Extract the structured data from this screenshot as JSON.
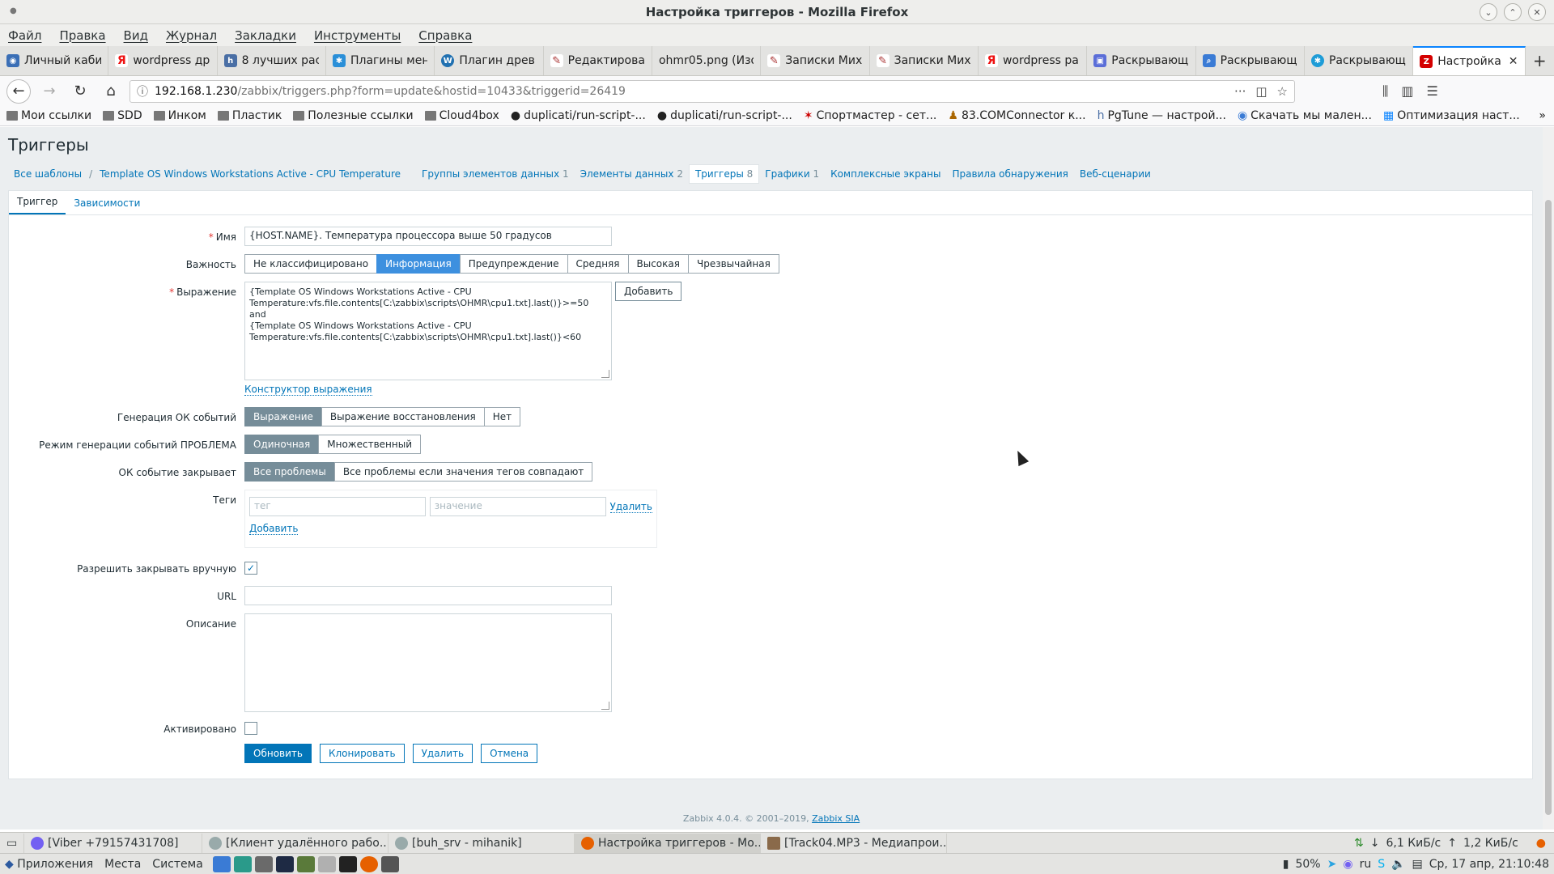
{
  "window": {
    "title": "Настройка триггеров - Mozilla Firefox"
  },
  "menubar": [
    "Файл",
    "Правка",
    "Вид",
    "Журнал",
    "Закладки",
    "Инструменты",
    "Справка"
  ],
  "tabs": [
    {
      "label": "Личный каби",
      "icon": "circle-icon",
      "color": "#3b6fb6"
    },
    {
      "label": "wordpress др",
      "icon": "yandex-icon",
      "color": "#e11"
    },
    {
      "label": "8 лучших рас",
      "icon": "h-icon",
      "color": "#4a6fa5"
    },
    {
      "label": "Плагины мен",
      "icon": "gear-icon",
      "color": "#2a8fd8"
    },
    {
      "label": "Плагин древ",
      "icon": "wordpress-icon",
      "color": "#2171b1"
    },
    {
      "label": "Редактирова",
      "icon": "feather-icon",
      "color": "#a33"
    },
    {
      "label": "ohmr05.png (Изо",
      "icon": "none",
      "color": "#e3e3e1"
    },
    {
      "label": "Записки Мих",
      "icon": "feather-icon",
      "color": "#a33"
    },
    {
      "label": "Записки Мих",
      "icon": "feather-icon",
      "color": "#a33"
    },
    {
      "label": "wordpress ра",
      "icon": "yandex-icon",
      "color": "#e11"
    },
    {
      "label": "Раскрывающ",
      "icon": "box-icon",
      "color": "#5b6ed8"
    },
    {
      "label": "Раскрывающ",
      "icon": "search-icon",
      "color": "#3a7bd5"
    },
    {
      "label": "Раскрывающ",
      "icon": "gear-icon",
      "color": "#1e9cd7"
    }
  ],
  "active_tab": {
    "label": "Настройка",
    "icon": "Z",
    "color": "#d40000"
  },
  "url": {
    "host": "192.168.1.230",
    "path": "/zabbix/triggers.php?form=update&hostid=10433&triggerid=26419"
  },
  "bookmarks": [
    {
      "label": "Мои ссылки",
      "type": "folder"
    },
    {
      "label": "SDD",
      "type": "folder"
    },
    {
      "label": "Инком",
      "type": "folder"
    },
    {
      "label": "Пластик",
      "type": "folder"
    },
    {
      "label": "Полезные ссылки",
      "type": "folder"
    },
    {
      "label": "Cloud4box",
      "type": "folder"
    },
    {
      "label": "duplicati/run-script-...",
      "type": "github"
    },
    {
      "label": "duplicati/run-script-...",
      "type": "github"
    },
    {
      "label": "Спортмастер - сет...",
      "type": "site"
    },
    {
      "label": "83.COMConnector к...",
      "type": "site"
    },
    {
      "label": "PgTune — настрой...",
      "type": "site"
    },
    {
      "label": "Скачать мы мален...",
      "type": "site"
    },
    {
      "label": "Оптимизация наст...",
      "type": "site"
    }
  ],
  "page": {
    "title": "Триггеры",
    "breadcrumbs": {
      "all_templates": "Все шаблоны",
      "template": "Template OS Windows Workstations Active - CPU Temperature",
      "items": [
        {
          "label": "Группы элементов данных",
          "count": "1"
        },
        {
          "label": "Элементы данных",
          "count": "2"
        },
        {
          "label": "Триггеры",
          "count": "8"
        },
        {
          "label": "Графики",
          "count": "1"
        },
        {
          "label": "Комплексные экраны",
          "count": ""
        },
        {
          "label": "Правила обнаружения",
          "count": ""
        },
        {
          "label": "Веб-сценарии",
          "count": ""
        }
      ]
    },
    "form_tabs": [
      "Триггер",
      "Зависимости"
    ],
    "form": {
      "name_label": "Имя",
      "name_value": "{HOST.NAME}. Температура процессора выше 50 градусов",
      "severity_label": "Важность",
      "severity_options": [
        "Не классифицировано",
        "Информация",
        "Предупреждение",
        "Средняя",
        "Высокая",
        "Чрезвычайная"
      ],
      "severity_selected": "Информация",
      "expression_label": "Выражение",
      "expression_value": "{Template OS Windows Workstations Active - CPU\nTemperature:vfs.file.contents[C:\\zabbix\\scripts\\OHMR\\cpu1.txt].last()}>=50 and\n{Template OS Windows Workstations Active - CPU\nTemperature:vfs.file.contents[C:\\zabbix\\scripts\\OHMR\\cpu1.txt].last()}<60",
      "add_button": "Добавить",
      "constructor_link": "Конструктор выражения",
      "ok_gen_label": "Генерация ОК событий",
      "ok_gen_options": [
        "Выражение",
        "Выражение восстановления",
        "Нет"
      ],
      "ok_gen_selected": "Выражение",
      "problem_mode_label": "Режим генерации событий ПРОБЛЕМА",
      "problem_mode_options": [
        "Одиночная",
        "Множественный"
      ],
      "problem_mode_selected": "Одиночная",
      "ok_close_label": "ОК событие закрывает",
      "ok_close_options": [
        "Все проблемы",
        "Все проблемы если значения тегов совпадают"
      ],
      "ok_close_selected": "Все проблемы",
      "tags_label": "Теги",
      "tag_placeholder": "тег",
      "value_placeholder": "значение",
      "tag_remove": "Удалить",
      "tag_add": "Добавить",
      "manual_close_label": "Разрешить закрывать вручную",
      "manual_close_checked": "✓",
      "url_label": "URL",
      "url_value": "",
      "description_label": "Описание",
      "description_value": "",
      "enabled_label": "Активировано",
      "enabled_checked": "",
      "buttons": {
        "update": "Обновить",
        "clone": "Клонировать",
        "delete": "Удалить",
        "cancel": "Отмена"
      }
    },
    "footer": {
      "text": "Zabbix 4.0.4. © 2001–2019, ",
      "link": "Zabbix SIA"
    }
  },
  "taskbar": {
    "windows": [
      {
        "label": "[Viber +79157431708]",
        "icon": "viber-icon",
        "color": "#7360f2"
      },
      {
        "label": "[Клиент удалённого рабо...",
        "icon": "remote-icon",
        "color": "#9aa"
      },
      {
        "label": "[buh_srv - mihanik]",
        "icon": "remote-icon",
        "color": "#9aa"
      },
      {
        "label": "Настройка триггеров - Мо...",
        "icon": "firefox-icon",
        "color": "#e66000"
      },
      {
        "label": "[Track04.MP3 - Медиапрои...",
        "icon": "media-icon",
        "color": "#8a6a4a"
      }
    ],
    "net_down": "6,1 КиБ/с",
    "net_up": "1,2 КиБ/с",
    "apps": "Приложения",
    "places": "Места",
    "system": "Система",
    "battery": "50%",
    "lang": "ru",
    "clock": "Ср, 17 апр, 21:10:48"
  }
}
